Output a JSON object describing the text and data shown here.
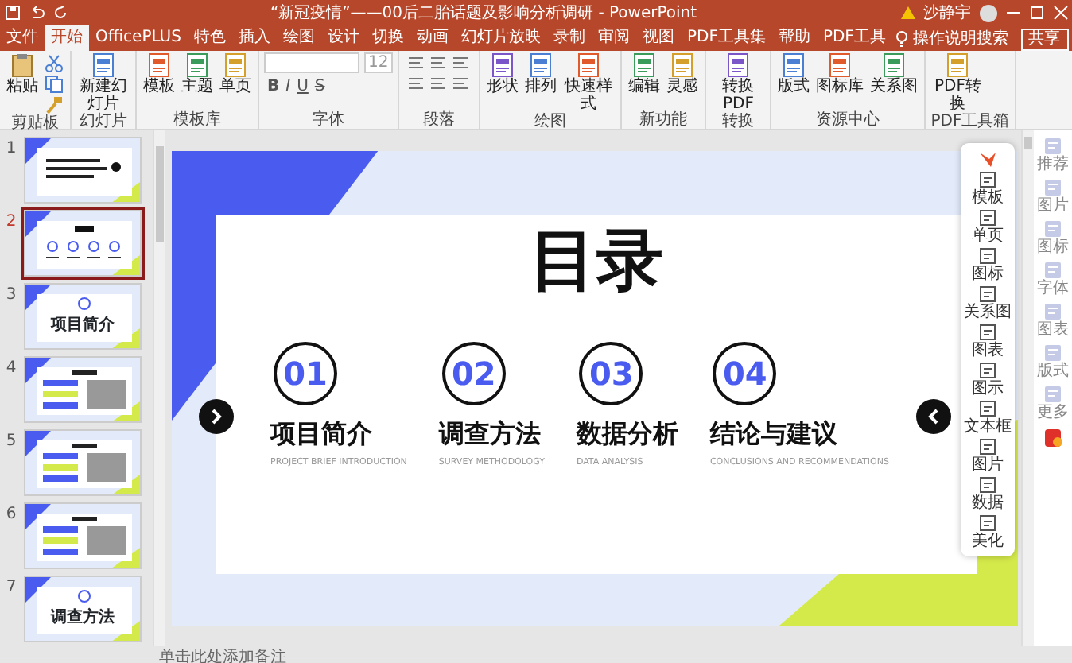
{
  "window": {
    "title": "“新冠疫情”——00后二胎话题及影响分析调研 - PowerPoint",
    "user": "沙静宇"
  },
  "tabs": [
    {
      "label": "文件",
      "selected": false
    },
    {
      "label": "开始",
      "selected": true
    },
    {
      "label": "OfficePLUS",
      "selected": false
    },
    {
      "label": "特色",
      "selected": false
    },
    {
      "label": "插入",
      "selected": false
    },
    {
      "label": "绘图",
      "selected": false
    },
    {
      "label": "设计",
      "selected": false
    },
    {
      "label": "切换",
      "selected": false
    },
    {
      "label": "动画",
      "selected": false
    },
    {
      "label": "幻灯片放映",
      "selected": false
    },
    {
      "label": "录制",
      "selected": false
    },
    {
      "label": "审阅",
      "selected": false
    },
    {
      "label": "视图",
      "selected": false
    },
    {
      "label": "PDF工具集",
      "selected": false
    },
    {
      "label": "帮助",
      "selected": false
    },
    {
      "label": "PDF工具",
      "selected": false
    }
  ],
  "tell_me": "操作说明搜索",
  "share": "共享",
  "ribbon": [
    {
      "label": "剪贴板",
      "kind": "clipboard",
      "buttons": [
        "粘贴"
      ]
    },
    {
      "label": "幻灯片",
      "kind": "buttons",
      "buttons": [
        "新建幻灯片"
      ]
    },
    {
      "label": "模板库",
      "kind": "buttons",
      "buttons": [
        "模板",
        "主题",
        "单页"
      ]
    },
    {
      "label": "字体",
      "kind": "font",
      "size": "12",
      "styles": [
        "B",
        "I",
        "U",
        "S"
      ]
    },
    {
      "label": "段落",
      "kind": "paragraph"
    },
    {
      "label": "绘图",
      "kind": "buttons",
      "buttons": [
        "形状",
        "排列",
        "快速样式"
      ]
    },
    {
      "label": "新功能",
      "kind": "buttons",
      "buttons": [
        "编辑",
        "灵感"
      ]
    },
    {
      "label": "转换",
      "kind": "buttons",
      "buttons": [
        "转换PDF"
      ]
    },
    {
      "label": "资源中心",
      "kind": "buttons",
      "buttons": [
        "版式",
        "图标库",
        "关系图"
      ]
    },
    {
      "label": "PDF工具箱",
      "kind": "buttons",
      "buttons": [
        "PDF转换"
      ]
    }
  ],
  "thumbnails": [
    {
      "number": "1",
      "selected": false,
      "kind": "cover"
    },
    {
      "number": "2",
      "selected": true,
      "kind": "toc"
    },
    {
      "number": "3",
      "selected": false,
      "kind": "section",
      "title": "项目简介"
    },
    {
      "number": "4",
      "selected": false,
      "kind": "content"
    },
    {
      "number": "5",
      "selected": false,
      "kind": "content"
    },
    {
      "number": "6",
      "selected": false,
      "kind": "content"
    },
    {
      "number": "7",
      "selected": false,
      "kind": "section",
      "title": "调查方法"
    }
  ],
  "slide": {
    "title": "目录",
    "items": [
      {
        "number": "01",
        "title": "项目简介",
        "subtitle": "PROJECT BRIEF INTRODUCTION"
      },
      {
        "number": "02",
        "title": "调查方法",
        "subtitle": "SURVEY METHODOLOGY"
      },
      {
        "number": "03",
        "title": "数据分析",
        "subtitle": "DATA ANALYSIS"
      },
      {
        "number": "04",
        "title": "结论与建议",
        "subtitle": "CONCLUSIONS AND RECOMMENDATIONS"
      }
    ]
  },
  "side_tools": [
    "模板",
    "单页",
    "图标",
    "关系图",
    "图表",
    "图示",
    "文本框",
    "图片",
    "数据",
    "美化"
  ],
  "assistant": [
    "推荐",
    "图片",
    "图标",
    "字体",
    "图表",
    "版式",
    "更多"
  ],
  "notes": {
    "placeholder": "单击此处添加备注"
  }
}
